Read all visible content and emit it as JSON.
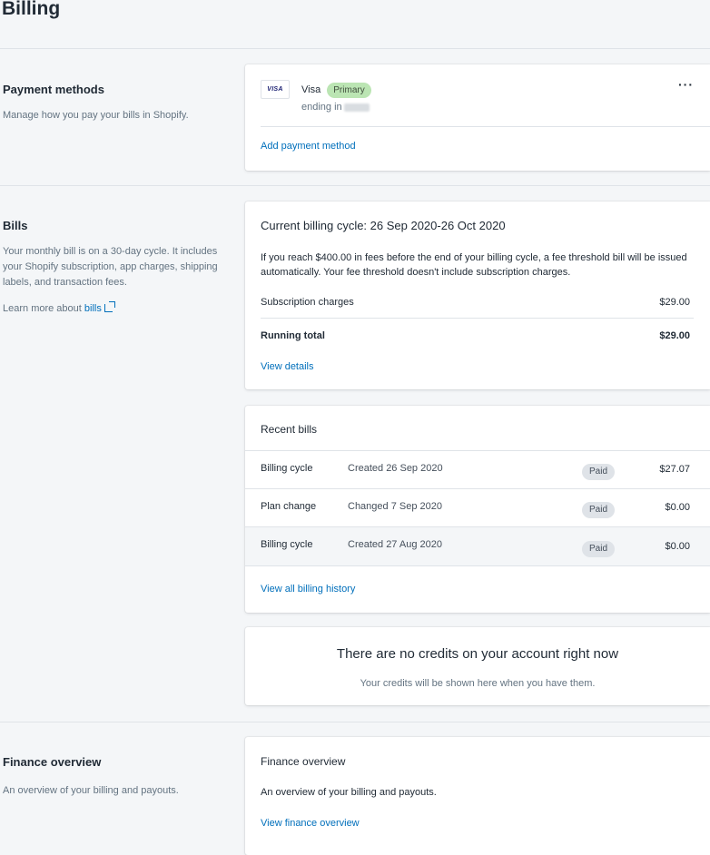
{
  "page": {
    "title": "Billing"
  },
  "payment_methods": {
    "heading": "Payment methods",
    "description": "Manage how you pay your bills in Shopify.",
    "card": {
      "brand_logo": "VISA",
      "brand": "Visa",
      "badge": "Primary",
      "ending_label": "ending in",
      "more_icon": "more-horizontal-icon",
      "add_link": "Add payment method"
    }
  },
  "bills": {
    "heading": "Bills",
    "description": "Your monthly bill is on a 30-day cycle. It includes your Shopify subscription, app charges, shipping labels, and transaction fees.",
    "learn_more_prefix": "Learn more about",
    "learn_more_link": "bills",
    "current_cycle": {
      "title": "Current billing cycle: 26 Sep 2020-26 Oct 2020",
      "notice": "If you reach $400.00 in fees before the end of your billing cycle, a fee threshold bill will be issued automatically. Your fee threshold doesn't include subscription charges.",
      "subscription_label": "Subscription charges",
      "subscription_value": "$29.00",
      "running_total_label": "Running total",
      "running_total_value": "$29.00",
      "view_details": "View details"
    },
    "recent_bills": {
      "title": "Recent bills",
      "rows": [
        {
          "type": "Billing cycle",
          "date": "Created 26 Sep 2020",
          "status": "Paid",
          "amount": "$27.07"
        },
        {
          "type": "Plan change",
          "date": "Changed 7 Sep 2020",
          "status": "Paid",
          "amount": "$0.00"
        },
        {
          "type": "Billing cycle",
          "date": "Created 27 Aug 2020",
          "status": "Paid",
          "amount": "$0.00"
        }
      ],
      "view_all": "View all billing history"
    },
    "credits": {
      "title": "There are no credits on your account right now",
      "subtitle": "Your credits will be shown here when you have them."
    }
  },
  "finance": {
    "heading": "Finance overview",
    "description": "An overview of your billing and payouts.",
    "card_title": "Finance overview",
    "card_description": "An overview of your billing and payouts.",
    "link": "View finance overview"
  },
  "colors": {
    "link": "#006fbb",
    "primary_badge": "#bbe5b3",
    "paid_badge": "#dfe3e8",
    "background": "#f4f6f8"
  }
}
